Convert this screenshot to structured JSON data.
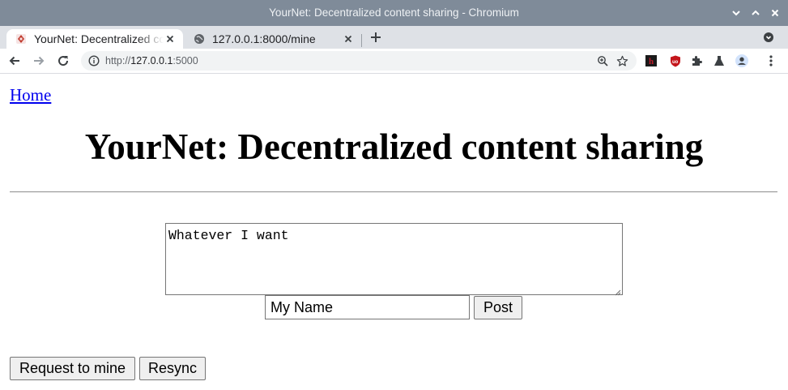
{
  "window": {
    "title": "YourNet: Decentralized content sharing - Chromium",
    "colors": {
      "titlebar": "#7f8b99",
      "tabstrip": "#dee1e6"
    }
  },
  "tabs": [
    {
      "title": "YourNet: Decentralized content sharing",
      "active": true,
      "icon": "app-favicon"
    },
    {
      "title": "127.0.0.1:8000/mine",
      "active": false,
      "icon": "globe-icon"
    }
  ],
  "address_bar": {
    "scheme": "http://",
    "host": "127.0.0.1",
    "port": ":5000"
  },
  "extensions": [
    "hypothesis-icon",
    "ublock-icon",
    "puzzle-icon",
    "flask-icon",
    "profile-icon",
    "menu-icon"
  ],
  "page": {
    "home_link": "Home",
    "heading": "YourNet: Decentralized content sharing",
    "post_text": "Whatever I want",
    "name_value": "My Name",
    "post_button": "Post",
    "request_button": "Request to mine",
    "resync_button": "Resync",
    "link_color": "#0000ee"
  }
}
